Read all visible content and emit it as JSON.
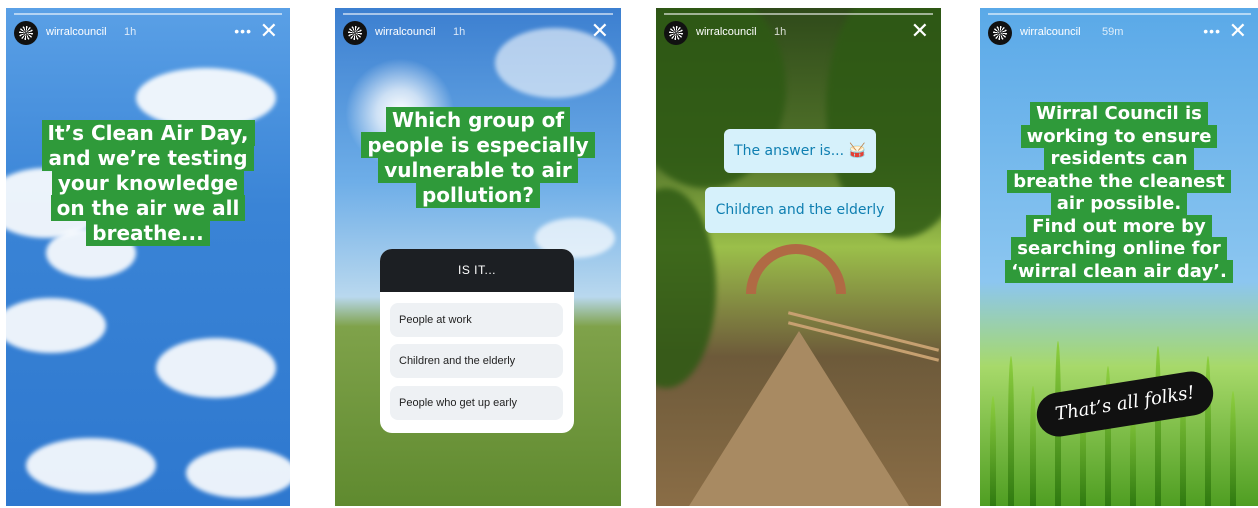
{
  "account": {
    "username": "wirralcouncil"
  },
  "stories": [
    {
      "time": "1h",
      "caption_lines": [
        "It’s Clean Air Day,",
        "and we’re testing",
        "your knowledge",
        "on the air we all",
        "breathe..."
      ]
    },
    {
      "time": "1h",
      "caption_lines": [
        "Which group of",
        "people is especially",
        "vulnerable to air",
        "pollution?"
      ],
      "poll": {
        "header": "IS IT...",
        "options": [
          "People at work",
          "Children and the elderly",
          "People who get up early"
        ]
      }
    },
    {
      "time": "1h",
      "answer_intro": "The answer is...",
      "answer_emoji": "🥁",
      "answer": "Children and the elderly"
    },
    {
      "time": "59m",
      "caption_lines": [
        "Wirral Council is",
        "working to ensure",
        "residents can",
        "breathe the cleanest",
        "air possible.",
        "Find out more by",
        "searching online for",
        "‘wirral clean air day’."
      ],
      "sticker": "That’s all folks!"
    }
  ],
  "icons": {
    "more": "more-options-icon",
    "close": "close-icon",
    "avatar": "wirral-council-logo-icon"
  },
  "colors": {
    "caption_bg": "#2f9a3a",
    "answer_text": "#0f7fb1",
    "answer_bg": "#d6f1fb"
  }
}
